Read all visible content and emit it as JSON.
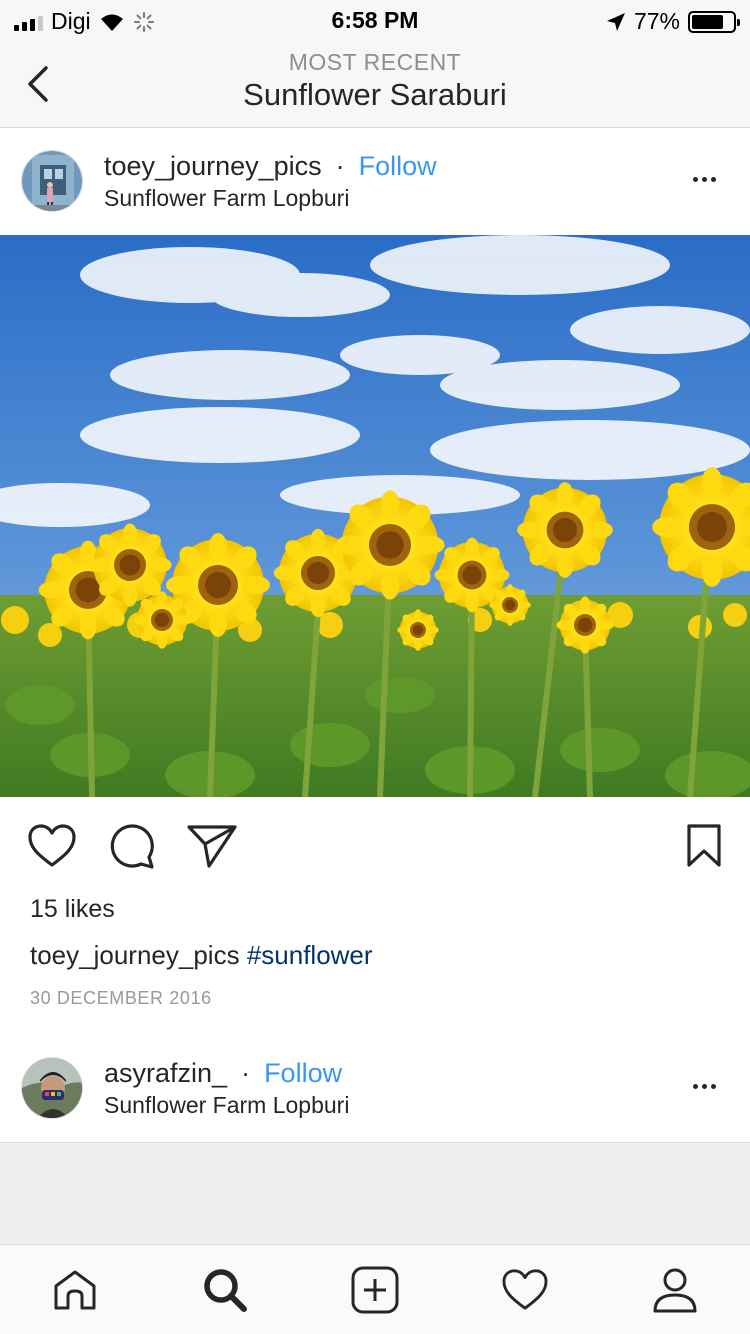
{
  "status_bar": {
    "carrier": "Digi",
    "time": "6:58 PM",
    "battery_percent": "77%",
    "battery_level": 0.77
  },
  "nav": {
    "subtitle": "MOST RECENT",
    "title": "Sunflower Saraburi"
  },
  "posts": [
    {
      "username": "toey_journey_pics",
      "separator": "·",
      "follow_label": "Follow",
      "location": "Sunflower Farm Lopburi",
      "likes": "15 likes",
      "caption_user": "toey_journey_pics",
      "caption_hashtag": "#sunflower",
      "date": "30 DECEMBER 2016"
    },
    {
      "username": "asyrafzin_",
      "separator": "·",
      "follow_label": "Follow",
      "location": "Sunflower Farm Lopburi"
    }
  ],
  "icons": {
    "back": "chevron-left-icon",
    "more": "more-icon",
    "like": "heart-icon",
    "comment": "comment-icon",
    "share": "share-icon",
    "save": "bookmark-icon",
    "tabs": [
      "home-icon",
      "search-icon",
      "add-post-icon",
      "activity-heart-icon",
      "profile-icon"
    ]
  },
  "colors": {
    "link_blue": "#3897f0",
    "hashtag": "#003569",
    "text": "#262626",
    "muted": "#8e8e8e"
  }
}
